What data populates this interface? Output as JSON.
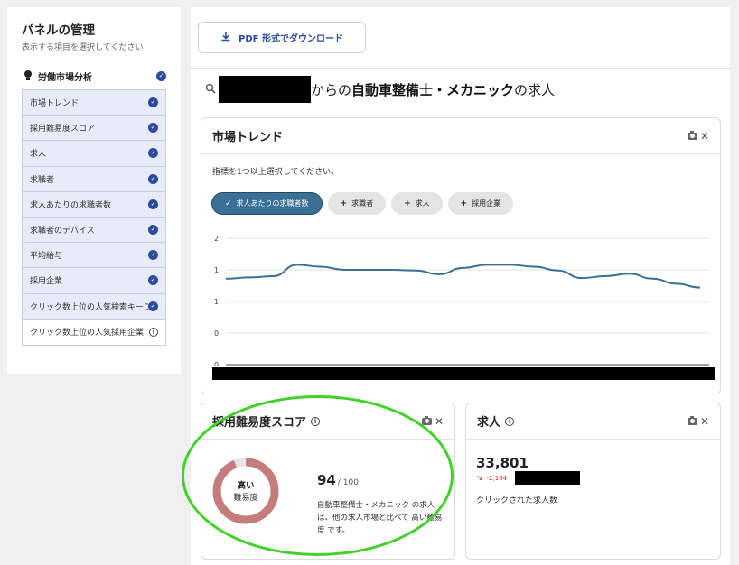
{
  "sidebar": {
    "title": "パネルの管理",
    "subtitle": "表示する項目を選択してください",
    "section_label": "労働市場分析",
    "items": [
      {
        "label": "市場トレンド",
        "checked": true
      },
      {
        "label": "採用難易度スコア",
        "checked": true
      },
      {
        "label": "求人",
        "checked": true
      },
      {
        "label": "求職者",
        "checked": true
      },
      {
        "label": "求人あたりの求職者数",
        "checked": true
      },
      {
        "label": "求職者のデバイス",
        "checked": true
      },
      {
        "label": "平均給与",
        "checked": true
      },
      {
        "label": "採用企業",
        "checked": true
      },
      {
        "label": "クリック数上位の人気検索キーワード",
        "checked": true
      },
      {
        "label": "クリック数上位の人気採用企業",
        "checked": false
      }
    ]
  },
  "toolbar": {
    "pdf_label": "PDF 形式でダウンロード"
  },
  "headline": {
    "prefix": "からの",
    "job": "自動車整備士・メカニック",
    "suffix": "の求人"
  },
  "trend_card": {
    "title": "市場トレンド",
    "hint": "指標を1つ以上選択してください。",
    "chips": [
      {
        "label": "求人あたりの求職者数",
        "selected": true
      },
      {
        "label": "求職者",
        "selected": false
      },
      {
        "label": "求人",
        "selected": false
      },
      {
        "label": "採用企業",
        "selected": false
      }
    ]
  },
  "chart_data": {
    "type": "line",
    "y_tick_labels": [
      "2",
      "1",
      "1",
      "0",
      "0"
    ],
    "series": [
      {
        "values": [
          1.36,
          1.38,
          1.4,
          1.58,
          1.55,
          1.5,
          1.5,
          1.5,
          1.49,
          1.43,
          1.53,
          1.58,
          1.58,
          1.55,
          1.49,
          1.37,
          1.4,
          1.44,
          1.36,
          1.28,
          1.22
        ],
        "color": "#3a7096"
      }
    ],
    "grid": true,
    "x_labels_redacted": true
  },
  "difficulty_card": {
    "title": "採用難易度スコア",
    "gauge_label_top": "高い",
    "gauge_label_bottom": "難易度",
    "score": "94",
    "score_max": "/ 100",
    "score_value": 94,
    "description": "自動車整備士・メカニック の求人は、他の求人市場と比べて 高い難易度 です。",
    "gauge_color": "#c47c7c"
  },
  "jobs_card": {
    "title": "求人",
    "count": "33,801",
    "delta": "-2,184",
    "caption": "クリックされた求人数"
  },
  "colors": {
    "accent": "#2b4a9e",
    "chip_selected": "#3a7096",
    "highlight": "#41d22a",
    "delta_negative": "#c0392b"
  }
}
